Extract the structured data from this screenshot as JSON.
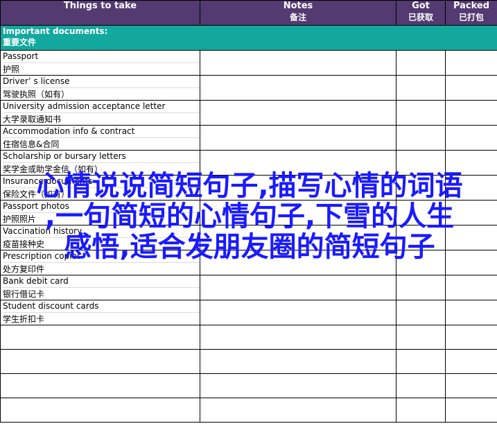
{
  "header": {
    "things": "Things to take",
    "notes_en": "Notes",
    "notes_zh": "备注",
    "got_en": "Got",
    "got_zh": "已获取",
    "packed_en": "Packed",
    "packed_zh": "已打包"
  },
  "section": {
    "title_en": "Important documents:",
    "title_zh": "重要文件"
  },
  "items": [
    {
      "en": "Passport",
      "zh": "护照"
    },
    {
      "en": "Driver’ s license",
      "zh": "驾驶执照（如有）"
    },
    {
      "en": "University admission acceptance letter",
      "zh": "大学录取通知书"
    },
    {
      "en": "Accommodation info & contract",
      "zh": "住宿信息&合同"
    },
    {
      "en": "Scholarship or bursary letters",
      "zh": "奖学金或助学金信（如有）"
    },
    {
      "en": "Insurance documents",
      "zh": "保险文件（如有）"
    },
    {
      "en": "Passport photos",
      "zh": "护照照片"
    },
    {
      "en": "Vaccination history",
      "zh": "疫苗接种史"
    },
    {
      "en": "Prescription copies",
      "zh": "处方复印件"
    },
    {
      "en": "Bank debit card",
      "zh": "银行借记卡"
    },
    {
      "en": "Student discount cards",
      "zh": "学生折扣卡"
    }
  ],
  "overlay": {
    "line1": "心情说说简短句子,描写心情的词语",
    "line2": ",一句简短的心情句子,下雪的人生",
    "line3": "感悟,适合发朋友圈的简短句子"
  }
}
